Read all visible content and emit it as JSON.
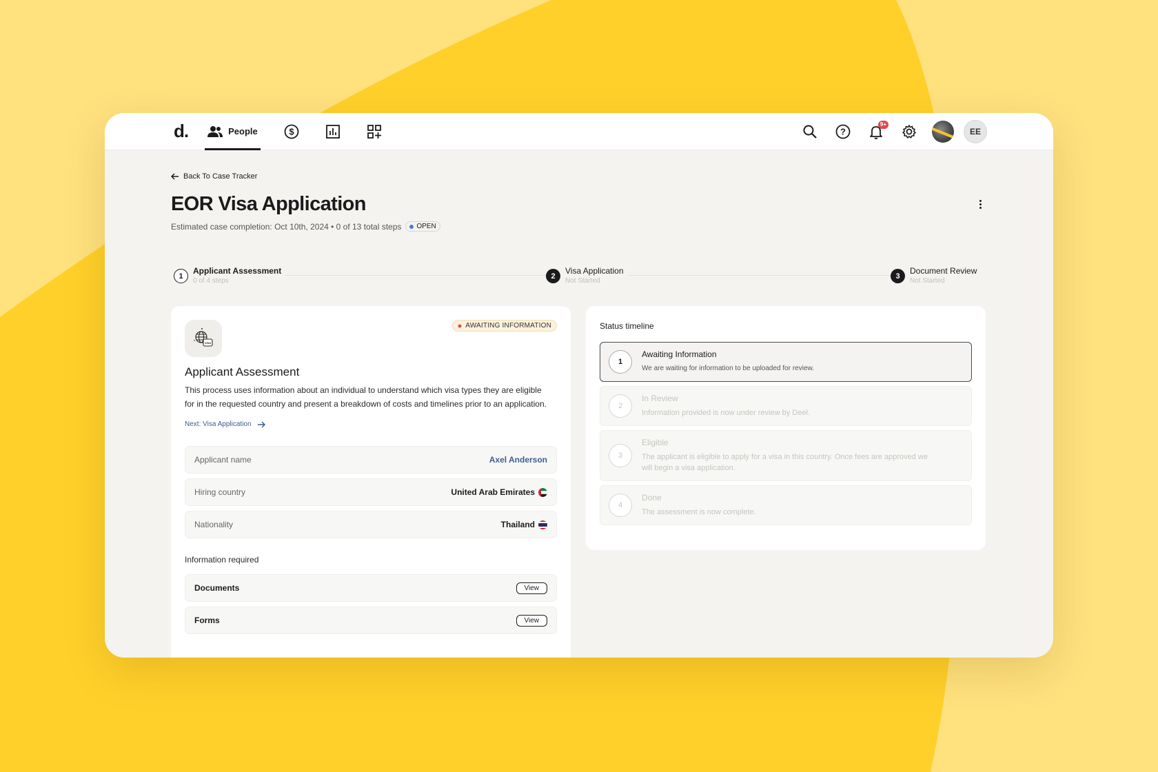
{
  "nav": {
    "logo": "d.",
    "people_label": "People",
    "notification_badge": "9+",
    "avatar_initials": "EE"
  },
  "header": {
    "back_label": "Back To Case Tracker",
    "title": "EOR Visa Application",
    "subtitle": "Estimated case completion: Oct 10th, 2024 • 0 of 13 total steps",
    "status": "OPEN"
  },
  "stepper": [
    {
      "num": "1",
      "title": "Applicant Assessment",
      "sub": "0 of 4 steps"
    },
    {
      "num": "2",
      "title": "Visa Application",
      "sub": "Not Started"
    },
    {
      "num": "3",
      "title": "Document Review",
      "sub": "Not Started"
    }
  ],
  "assessment": {
    "status": "AWAITING INFORMATION",
    "title": "Applicant Assessment",
    "description": "This process uses information about an individual to understand which visa types they are eligible for in the requested country and present a breakdown of costs and timelines prior to an application.",
    "next_link": "Next: Visa Application",
    "rows": [
      {
        "label": "Applicant name",
        "value": "Axel Anderson"
      },
      {
        "label": "Hiring country",
        "value": "United Arab Emirates"
      },
      {
        "label": "Nationality",
        "value": "Thailand"
      }
    ],
    "required_label": "Information required",
    "required": [
      {
        "label": "Documents",
        "button": "View"
      },
      {
        "label": "Forms",
        "button": "View"
      }
    ]
  },
  "timeline": {
    "title": "Status timeline",
    "items": [
      {
        "num": "1",
        "title": "Awaiting Information",
        "desc": "We are waiting for information to be uploaded for review."
      },
      {
        "num": "2",
        "title": "In Review",
        "desc": "Information provided is now under review by Deel."
      },
      {
        "num": "3",
        "title": "Eligible",
        "desc": "The applicant is eligible to apply for a visa in this country. Once fees are approved we will begin a visa application."
      },
      {
        "num": "4",
        "title": "Done",
        "desc": "The assessment is now complete."
      }
    ]
  },
  "colors": {
    "background": "#ffd02a",
    "background_light": "#ffe17e",
    "accent_link": "#3e5e92",
    "badge_red": "#e0474c"
  }
}
